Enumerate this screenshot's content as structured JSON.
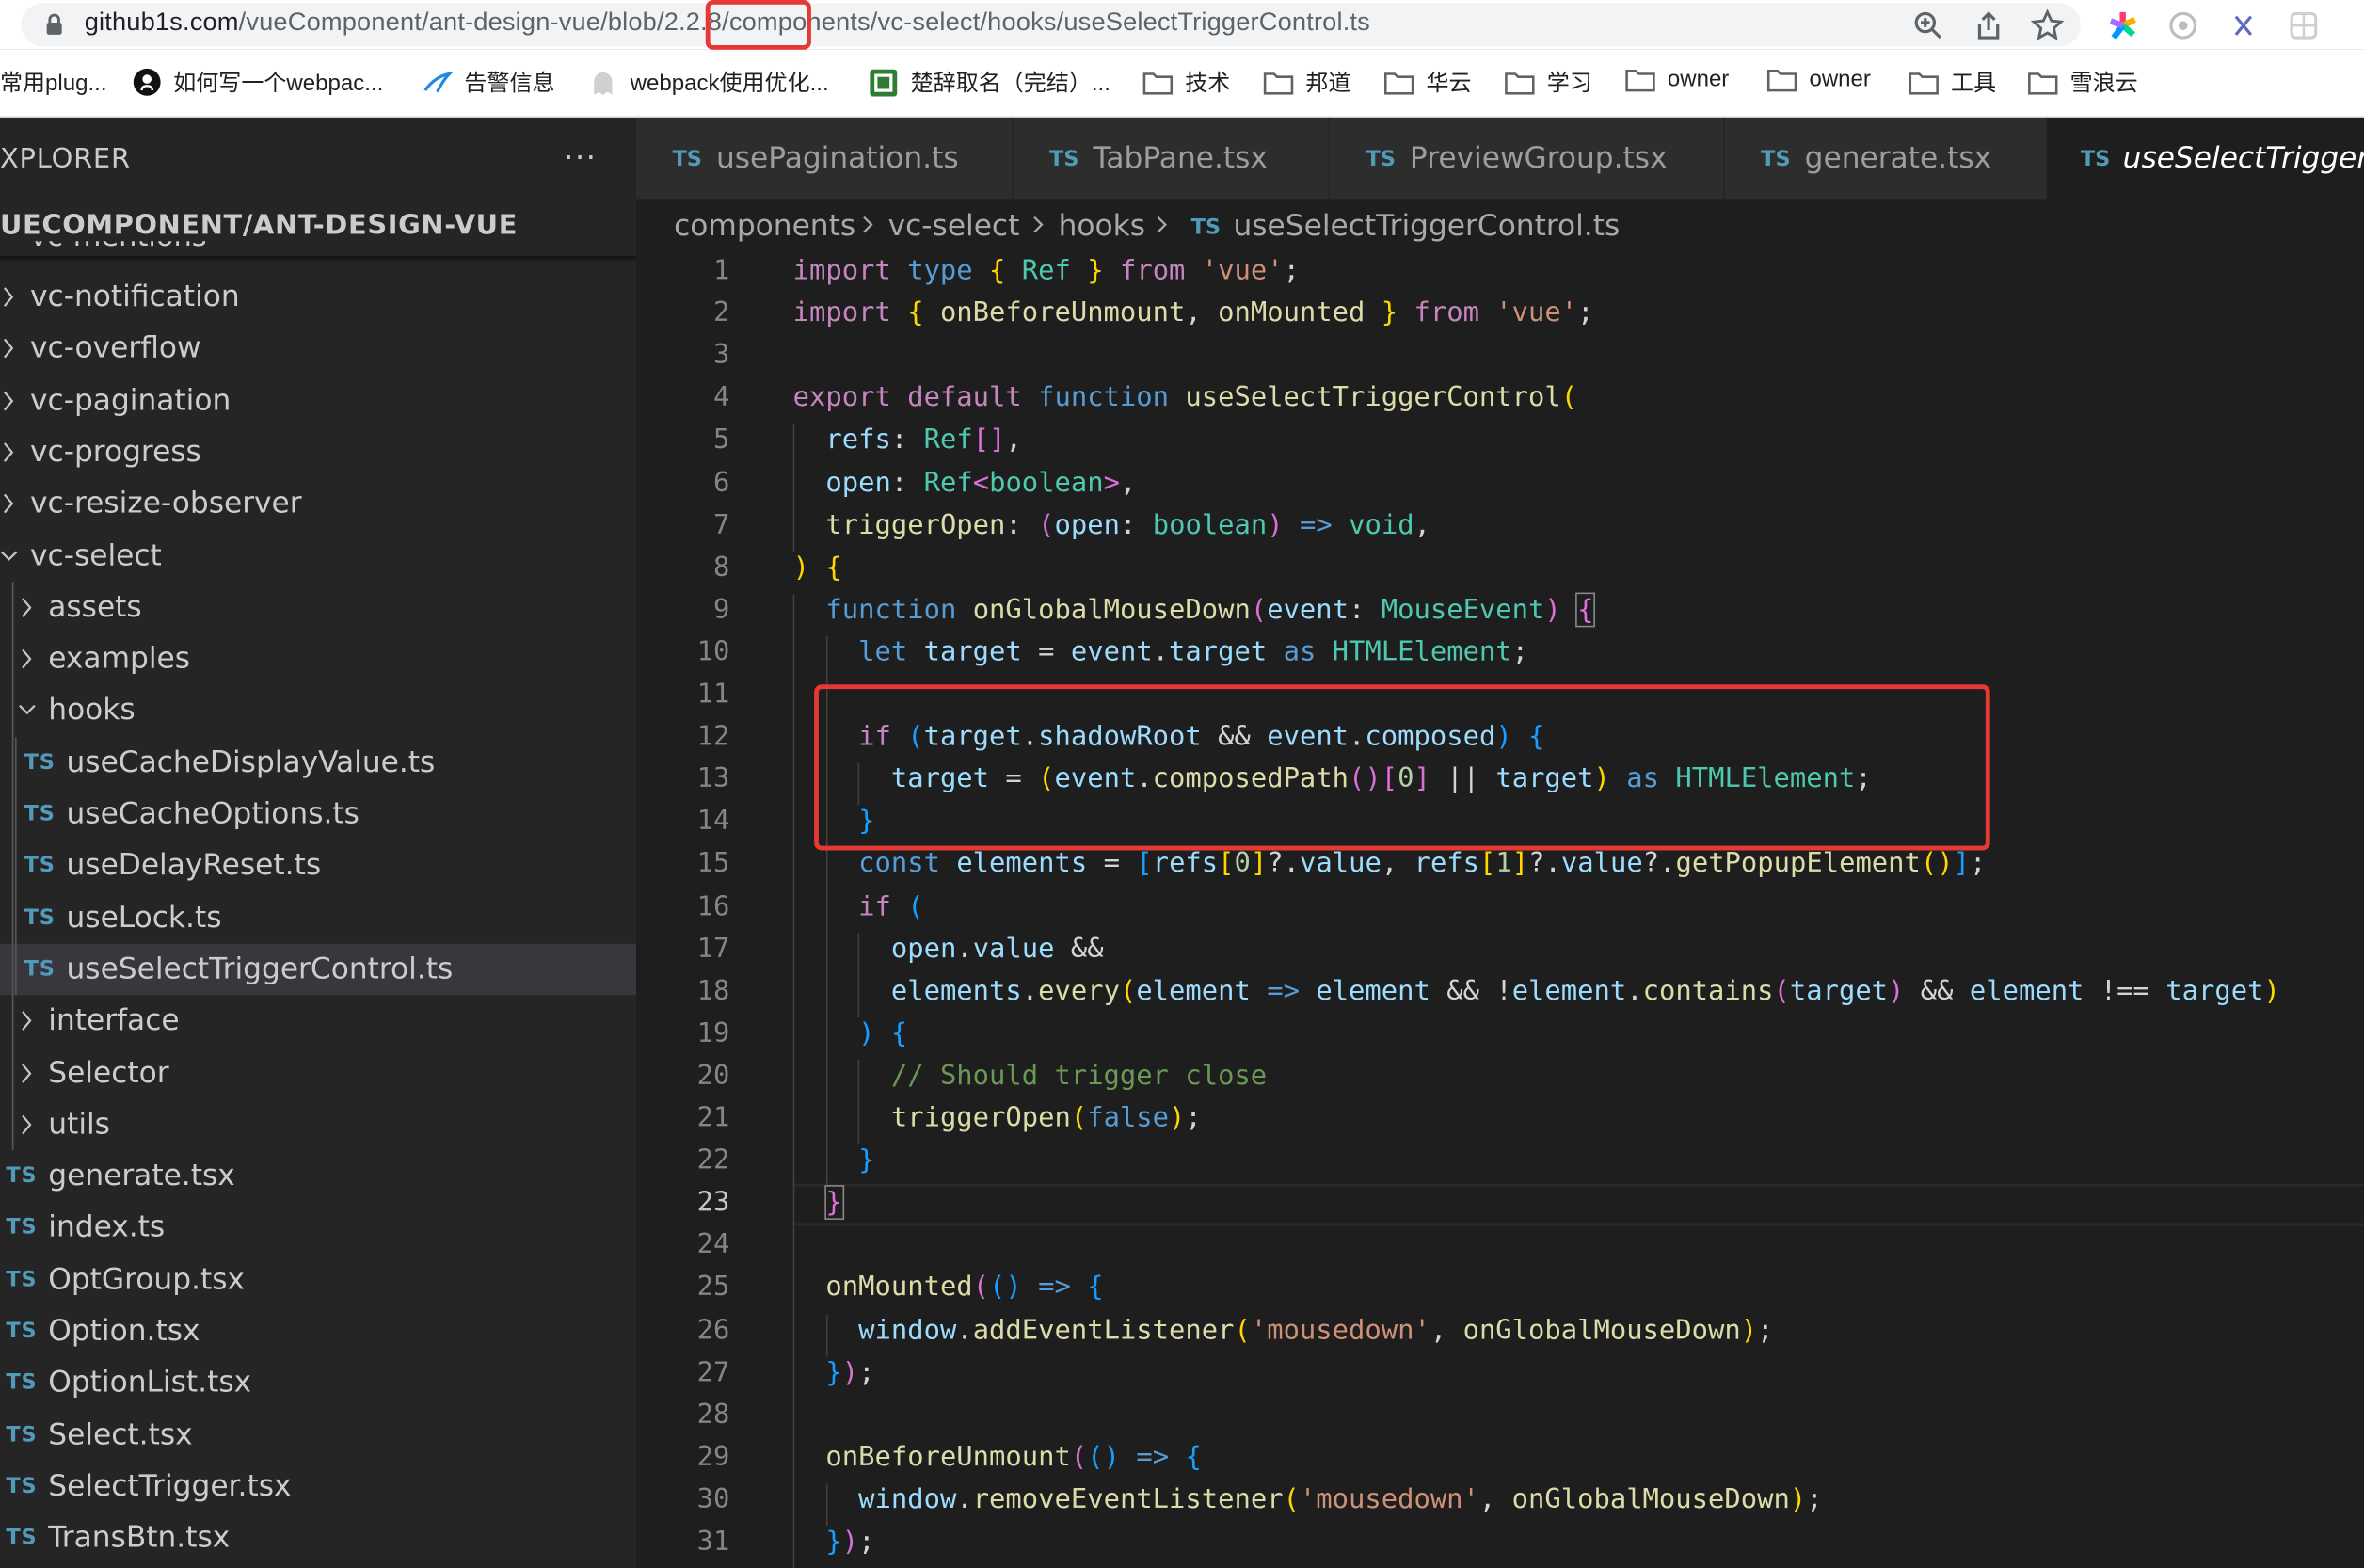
{
  "browser": {
    "url_host": "github1s.com",
    "url_path_before": "/vueComponent/ant-design-vue/blob",
    "url_version": "/2.2.8/",
    "url_path_after": "components/vc-select/hooks/useSelectTriggerControl.ts",
    "bookmarks": [
      "常用plug...",
      "如何写一个webpac...",
      "告警信息",
      "webpack使用优化...",
      "楚辞取名（完结）...",
      "技术",
      "邦道",
      "华云",
      "学习",
      "owner",
      "owner",
      "工具",
      "雪浪云"
    ]
  },
  "sidebar": {
    "title": "XPLORER",
    "more": "···",
    "root": "UECOMPONENT/ANT-DESIGN-VUE",
    "peek": "vc-mentions",
    "items": [
      {
        "label": "vc-notification",
        "kind": "folder",
        "depth": 0,
        "open": false
      },
      {
        "label": "vc-overflow",
        "kind": "folder",
        "depth": 0,
        "open": false
      },
      {
        "label": "vc-pagination",
        "kind": "folder",
        "depth": 0,
        "open": false
      },
      {
        "label": "vc-progress",
        "kind": "folder",
        "depth": 0,
        "open": false
      },
      {
        "label": "vc-resize-observer",
        "kind": "folder",
        "depth": 0,
        "open": false
      },
      {
        "label": "vc-select",
        "kind": "folder",
        "depth": 0,
        "open": true
      },
      {
        "label": "assets",
        "kind": "folder",
        "depth": 1,
        "open": false
      },
      {
        "label": "examples",
        "kind": "folder",
        "depth": 1,
        "open": false
      },
      {
        "label": "hooks",
        "kind": "folder",
        "depth": 1,
        "open": true
      },
      {
        "label": "useCacheDisplayValue.ts",
        "kind": "ts",
        "depth": 2
      },
      {
        "label": "useCacheOptions.ts",
        "kind": "ts",
        "depth": 2
      },
      {
        "label": "useDelayReset.ts",
        "kind": "ts",
        "depth": 2
      },
      {
        "label": "useLock.ts",
        "kind": "ts",
        "depth": 2
      },
      {
        "label": "useSelectTriggerControl.ts",
        "kind": "ts",
        "depth": 2,
        "selected": true
      },
      {
        "label": "interface",
        "kind": "folder",
        "depth": 1,
        "open": false
      },
      {
        "label": "Selector",
        "kind": "folder",
        "depth": 1,
        "open": false
      },
      {
        "label": "utils",
        "kind": "folder",
        "depth": 1,
        "open": false
      },
      {
        "label": "generate.tsx",
        "kind": "ts",
        "depth": 1
      },
      {
        "label": "index.ts",
        "kind": "ts",
        "depth": 1
      },
      {
        "label": "OptGroup.tsx",
        "kind": "ts",
        "depth": 1
      },
      {
        "label": "Option.tsx",
        "kind": "ts",
        "depth": 1
      },
      {
        "label": "OptionList.tsx",
        "kind": "ts",
        "depth": 1
      },
      {
        "label": "Select.tsx",
        "kind": "ts",
        "depth": 1
      },
      {
        "label": "SelectTrigger.tsx",
        "kind": "ts",
        "depth": 1
      },
      {
        "label": "TransBtn.tsx",
        "kind": "ts",
        "depth": 1
      }
    ]
  },
  "tabs": [
    {
      "icon": "TS",
      "label": "usePagination.ts"
    },
    {
      "icon": "TS",
      "label": "TabPane.tsx"
    },
    {
      "icon": "TS",
      "label": "PreviewGroup.tsx"
    },
    {
      "icon": "TS",
      "label": "generate.tsx"
    },
    {
      "icon": "TS",
      "label": "useSelectTrigger",
      "active": true
    }
  ],
  "breadcrumb": [
    "components",
    "vc-select",
    "hooks",
    "useSelectTriggerControl.ts"
  ],
  "breadcrumb_icon": "TS",
  "editor": {
    "current_line": 23,
    "lines": [
      [
        [
          "c",
          "import "
        ],
        [
          "k",
          "type "
        ],
        [
          "y",
          "{ "
        ],
        [
          "t",
          "Ref "
        ],
        [
          "y",
          "} "
        ],
        [
          "c",
          "from "
        ],
        [
          "s",
          "'vue'"
        ],
        [
          "o",
          ";"
        ]
      ],
      [
        [
          "c",
          "import "
        ],
        [
          "y",
          "{ "
        ],
        [
          "f",
          "onBeforeUnmount"
        ],
        [
          "o",
          ", "
        ],
        [
          "f",
          "onMounted "
        ],
        [
          "y",
          "} "
        ],
        [
          "c",
          "from "
        ],
        [
          "s",
          "'vue'"
        ],
        [
          "o",
          ";"
        ]
      ],
      [],
      [
        [
          "c",
          "export "
        ],
        [
          "c",
          "default "
        ],
        [
          "k",
          "function "
        ],
        [
          "f",
          "useSelectTriggerControl"
        ],
        [
          "y",
          "("
        ]
      ],
      [
        [
          "o",
          "  "
        ],
        [
          "v",
          "refs"
        ],
        [
          "o",
          ": "
        ],
        [
          "t",
          "Ref"
        ],
        [
          "p",
          "[]"
        ],
        [
          "o",
          ","
        ]
      ],
      [
        [
          "o",
          "  "
        ],
        [
          "v",
          "open"
        ],
        [
          "o",
          ": "
        ],
        [
          "t",
          "Ref"
        ],
        [
          "p",
          "<"
        ],
        [
          "t",
          "boolean"
        ],
        [
          "p",
          ">"
        ],
        [
          "o",
          ","
        ]
      ],
      [
        [
          "o",
          "  "
        ],
        [
          "f",
          "triggerOpen"
        ],
        [
          "o",
          ": "
        ],
        [
          "p",
          "("
        ],
        [
          "v",
          "open"
        ],
        [
          "o",
          ": "
        ],
        [
          "t",
          "boolean"
        ],
        [
          "p",
          ")"
        ],
        [
          "o",
          " "
        ],
        [
          "k",
          "=>"
        ],
        [
          "o",
          " "
        ],
        [
          "t",
          "void"
        ],
        [
          "o",
          ","
        ]
      ],
      [
        [
          "y",
          ")"
        ],
        [
          "o",
          " "
        ],
        [
          "y",
          "{"
        ]
      ],
      [
        [
          "o",
          "  "
        ],
        [
          "k",
          "function "
        ],
        [
          "f",
          "onGlobalMouseDown"
        ],
        [
          "p",
          "("
        ],
        [
          "v",
          "event"
        ],
        [
          "o",
          ": "
        ],
        [
          "t",
          "MouseEvent"
        ],
        [
          "p",
          ")"
        ],
        [
          "o",
          " "
        ],
        [
          "p",
          "{"
        ]
      ],
      [
        [
          "o",
          "    "
        ],
        [
          "k",
          "let "
        ],
        [
          "v",
          "target "
        ],
        [
          "o",
          "= "
        ],
        [
          "v",
          "event"
        ],
        [
          "o",
          "."
        ],
        [
          "v",
          "target "
        ],
        [
          "k",
          "as "
        ],
        [
          "t",
          "HTMLElement"
        ],
        [
          "o",
          ";"
        ]
      ],
      [],
      [
        [
          "o",
          "    "
        ],
        [
          "c",
          "if "
        ],
        [
          "b",
          "("
        ],
        [
          "v",
          "target"
        ],
        [
          "o",
          "."
        ],
        [
          "v",
          "shadowRoot "
        ],
        [
          "o",
          "&& "
        ],
        [
          "v",
          "event"
        ],
        [
          "o",
          "."
        ],
        [
          "v",
          "composed"
        ],
        [
          "b",
          ")"
        ],
        [
          "o",
          " "
        ],
        [
          "b",
          "{"
        ]
      ],
      [
        [
          "o",
          "      "
        ],
        [
          "v",
          "target "
        ],
        [
          "o",
          "= "
        ],
        [
          "y",
          "("
        ],
        [
          "v",
          "event"
        ],
        [
          "o",
          "."
        ],
        [
          "f",
          "composedPath"
        ],
        [
          "p",
          "()"
        ],
        [
          "p",
          "["
        ],
        [
          "n",
          "0"
        ],
        [
          "p",
          "]"
        ],
        [
          "o",
          " || "
        ],
        [
          "v",
          "target"
        ],
        [
          "y",
          ")"
        ],
        [
          "o",
          " "
        ],
        [
          "k",
          "as "
        ],
        [
          "t",
          "HTMLElement"
        ],
        [
          "o",
          ";"
        ]
      ],
      [
        [
          "o",
          "    "
        ],
        [
          "b",
          "}"
        ]
      ],
      [
        [
          "o",
          "    "
        ],
        [
          "k",
          "const "
        ],
        [
          "v",
          "elements "
        ],
        [
          "o",
          "= "
        ],
        [
          "b",
          "["
        ],
        [
          "v",
          "refs"
        ],
        [
          "y",
          "["
        ],
        [
          "n",
          "0"
        ],
        [
          "y",
          "]"
        ],
        [
          "o",
          "?."
        ],
        [
          "v",
          "value"
        ],
        [
          "o",
          ", "
        ],
        [
          "v",
          "refs"
        ],
        [
          "y",
          "["
        ],
        [
          "n",
          "1"
        ],
        [
          "y",
          "]"
        ],
        [
          "o",
          "?."
        ],
        [
          "v",
          "value"
        ],
        [
          "o",
          "?."
        ],
        [
          "f",
          "getPopupElement"
        ],
        [
          "y",
          "()"
        ],
        [
          "b",
          "]"
        ],
        [
          "o",
          ";"
        ]
      ],
      [
        [
          "o",
          "    "
        ],
        [
          "c",
          "if "
        ],
        [
          "b",
          "("
        ]
      ],
      [
        [
          "o",
          "      "
        ],
        [
          "v",
          "open"
        ],
        [
          "o",
          "."
        ],
        [
          "v",
          "value "
        ],
        [
          "o",
          "&&"
        ]
      ],
      [
        [
          "o",
          "      "
        ],
        [
          "v",
          "elements"
        ],
        [
          "o",
          "."
        ],
        [
          "f",
          "every"
        ],
        [
          "y",
          "("
        ],
        [
          "v",
          "element "
        ],
        [
          "k",
          "=>"
        ],
        [
          "o",
          " "
        ],
        [
          "v",
          "element "
        ],
        [
          "o",
          "&& !"
        ],
        [
          "v",
          "element"
        ],
        [
          "o",
          "."
        ],
        [
          "f",
          "contains"
        ],
        [
          "p",
          "("
        ],
        [
          "v",
          "target"
        ],
        [
          "p",
          ")"
        ],
        [
          "o",
          " && "
        ],
        [
          "v",
          "element "
        ],
        [
          "o",
          "!== "
        ],
        [
          "v",
          "target"
        ],
        [
          "y",
          ")"
        ]
      ],
      [
        [
          "o",
          "    "
        ],
        [
          "b",
          ")"
        ],
        [
          "o",
          " "
        ],
        [
          "b",
          "{"
        ]
      ],
      [
        [
          "o",
          "      "
        ],
        [
          "cm",
          "// Should trigger close"
        ]
      ],
      [
        [
          "o",
          "      "
        ],
        [
          "f",
          "triggerOpen"
        ],
        [
          "y",
          "("
        ],
        [
          "k",
          "false"
        ],
        [
          "y",
          ")"
        ],
        [
          "o",
          ";"
        ]
      ],
      [
        [
          "o",
          "    "
        ],
        [
          "b",
          "}"
        ]
      ],
      [
        [
          "o",
          "  "
        ],
        [
          "p",
          "}"
        ]
      ],
      [],
      [
        [
          "o",
          "  "
        ],
        [
          "f",
          "onMounted"
        ],
        [
          "p",
          "("
        ],
        [
          "b",
          "()"
        ],
        [
          "o",
          " "
        ],
        [
          "k",
          "=>"
        ],
        [
          "o",
          " "
        ],
        [
          "b",
          "{"
        ]
      ],
      [
        [
          "o",
          "    "
        ],
        [
          "v",
          "window"
        ],
        [
          "o",
          "."
        ],
        [
          "f",
          "addEventListener"
        ],
        [
          "y",
          "("
        ],
        [
          "s",
          "'mousedown'"
        ],
        [
          "o",
          ", "
        ],
        [
          "f",
          "onGlobalMouseDown"
        ],
        [
          "y",
          ")"
        ],
        [
          "o",
          ";"
        ]
      ],
      [
        [
          "o",
          "  "
        ],
        [
          "b",
          "}"
        ],
        [
          "p",
          ")"
        ],
        [
          "o",
          ";"
        ]
      ],
      [],
      [
        [
          "o",
          "  "
        ],
        [
          "f",
          "onBeforeUnmount"
        ],
        [
          "p",
          "("
        ],
        [
          "b",
          "()"
        ],
        [
          "o",
          " "
        ],
        [
          "k",
          "=>"
        ],
        [
          "o",
          " "
        ],
        [
          "b",
          "{"
        ]
      ],
      [
        [
          "o",
          "    "
        ],
        [
          "v",
          "window"
        ],
        [
          "o",
          "."
        ],
        [
          "f",
          "removeEventListener"
        ],
        [
          "y",
          "("
        ],
        [
          "s",
          "'mousedown'"
        ],
        [
          "o",
          ", "
        ],
        [
          "f",
          "onGlobalMouseDown"
        ],
        [
          "y",
          ")"
        ],
        [
          "o",
          ";"
        ]
      ],
      [
        [
          "o",
          "  "
        ],
        [
          "b",
          "}"
        ],
        [
          "p",
          ")"
        ],
        [
          "o",
          ";"
        ]
      ]
    ]
  }
}
